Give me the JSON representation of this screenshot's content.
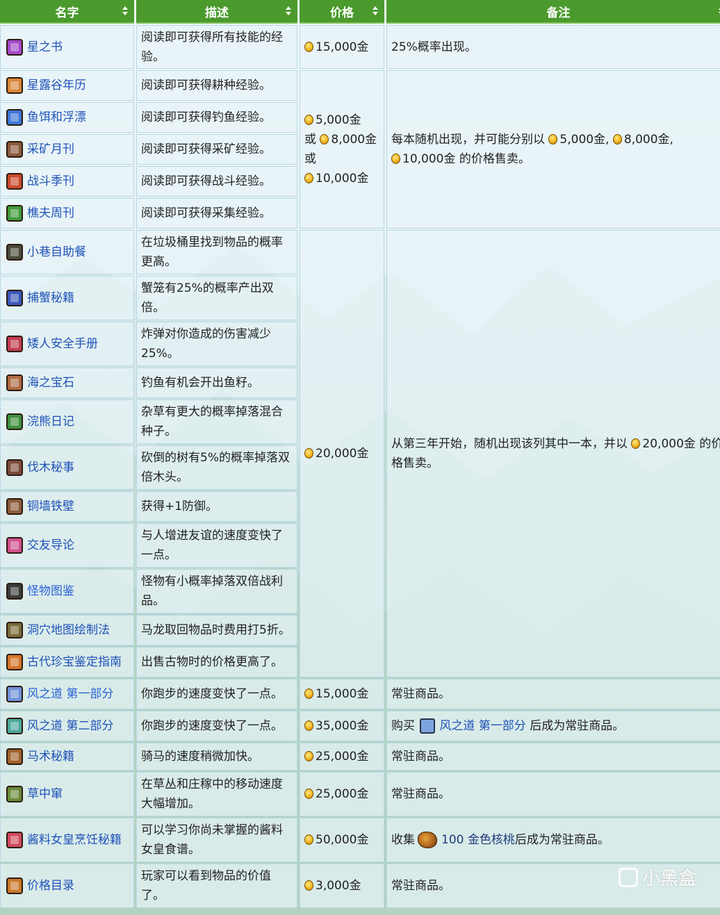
{
  "headers": {
    "name": "名字",
    "desc": "描述",
    "price": "价格",
    "note": "备注"
  },
  "rows": [
    {
      "name": "星之书",
      "desc": "阅读即可获得所有技能的经验。",
      "icon": "star-book-icon",
      "color": "#a347c8"
    },
    {
      "name": "星露谷年历",
      "desc": "阅读即可获得耕种经验。",
      "icon": "almanac-book-icon",
      "color": "#d8873a"
    },
    {
      "name": "鱼饵和浮漂",
      "desc": "阅读即可获得钓鱼经验。",
      "icon": "fishing-book-icon",
      "color": "#3c76d6"
    },
    {
      "name": "采矿月刊",
      "desc": "阅读即可获得采矿经验。",
      "icon": "mining-book-icon",
      "color": "#8a5a3c"
    },
    {
      "name": "战斗季刊",
      "desc": "阅读即可获得战斗经验。",
      "icon": "combat-book-icon",
      "color": "#c94a2c"
    },
    {
      "name": "樵夫周刊",
      "desc": "阅读即可获得采集经验。",
      "icon": "foraging-book-icon",
      "color": "#3f9a3a"
    },
    {
      "name": "小巷自助餐",
      "desc": "在垃圾桶里找到物品的概率更高。",
      "icon": "trash-book-icon",
      "color": "#4a4a3a"
    },
    {
      "name": "捕蟹秘籍",
      "desc": "蟹笼有25%的概率产出双倍。",
      "icon": "crab-book-icon",
      "color": "#3a56b8"
    },
    {
      "name": "矮人安全手册",
      "desc": "炸弹对你造成的伤害减少25%。",
      "icon": "dwarf-book-icon",
      "color": "#c23c4e"
    },
    {
      "name": "海之宝石",
      "desc": "钓鱼有机会开出鱼籽。",
      "icon": "jewels-book-icon",
      "color": "#b06a44"
    },
    {
      "name": "浣熊日记",
      "desc": "杂草有更大的概率掉落混合种子。",
      "icon": "raccoon-book-icon",
      "color": "#3f8f3f"
    },
    {
      "name": "伐木秘事",
      "desc": "砍倒的树有5%的概率掉落双倍木头。",
      "icon": "woodcutter-book-icon",
      "color": "#7a4a3a"
    },
    {
      "name": "铜墙铁壁",
      "desc": "获得+1防御。",
      "icon": "defense-book-icon",
      "color": "#8a5a3a"
    },
    {
      "name": "交友导论",
      "desc": "与人增进友谊的速度变快了一点。",
      "icon": "friendship-book-icon",
      "color": "#d0508a"
    },
    {
      "name": "怪物图鉴",
      "desc": "怪物有小概率掉落双倍战利品。",
      "icon": "monster-book-icon",
      "color": "#3a3a3a",
      "link": true
    },
    {
      "name": "洞穴地图绘制法",
      "desc": "马龙取回物品时费用打5折。",
      "icon": "map-book-icon",
      "color": "#7a6a3a"
    },
    {
      "name": "古代珍宝鉴定指南",
      "desc": "出售古物时的价格更高了。",
      "icon": "artifact-book-icon",
      "color": "#d4742a"
    },
    {
      "name": "风之道 第一部分",
      "desc": "你跑步的速度变快了一点。",
      "icon": "wind-book-1-icon",
      "color": "#6f8fd8",
      "link": true
    },
    {
      "name": "风之道 第二部分",
      "desc": "你跑步的速度变快了一点。",
      "icon": "wind-book-2-icon",
      "color": "#4aa89a"
    },
    {
      "name": "马术秘籍",
      "desc": "骑马的速度稍微加快。",
      "icon": "horse-book-icon",
      "color": "#a0622a"
    },
    {
      "name": "草中窜",
      "desc": "在草丛和庄稼中的移动速度大幅增加。",
      "icon": "grass-book-icon",
      "color": "#6a8a3a"
    },
    {
      "name": "酱料女皇烹饪秘籍",
      "desc": "可以学习你尚未掌握的酱料女皇食谱。",
      "icon": "queen-sauce-book-icon",
      "color": "#d04a5a"
    },
    {
      "name": "价格目录",
      "desc": "玩家可以看到物品的价值了。",
      "icon": "price-catalog-icon",
      "color": "#c9782a"
    }
  ],
  "prices": {
    "p1": "15,000金",
    "p2a": "5,000金",
    "or": "或",
    "p2b": "8,000金",
    "p2c": "10,000金",
    "p3": "20,000金",
    "p4": "15,000金",
    "p5": "35,000金",
    "p6": "25,000金",
    "p7": "25,000金",
    "p8": "50,000金",
    "p9": "3,000金"
  },
  "notes": {
    "n1": "25%概率出现。",
    "n2_pre": "每本随机出现，并可能分别以",
    "n2_a": "5,000金,",
    "n2_b": "8,000金,",
    "n2_c": "10,000金 的价格售卖。",
    "n3_pre": "从第三年开始，随机出现该列其中一本，并以",
    "n3_post": "20,000金 的价格售卖。",
    "permanent": "常驻商品。",
    "n5_pre": "购买",
    "n5_link": "风之道 第一部分",
    "n5_post": "后成为常驻商品。",
    "n8_pre": "收集",
    "n8_item": "100 金色核桃",
    "n8_post": "后成为常驻商品。"
  },
  "watermark": "小黑盒"
}
